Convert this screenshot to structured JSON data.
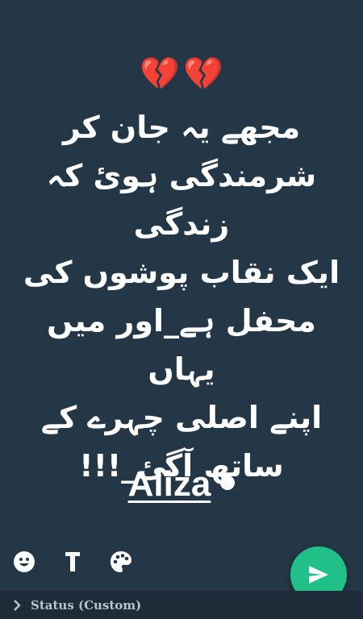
{
  "canvas": {
    "background": "#243746",
    "emoji": [
      "💔",
      "💔"
    ],
    "status_text": "مجھے یہ جان کر\nشرمندگی ہوئ کہ زندگی\nایک نقاب پوشوں کی\nمحفل ہے_اور میں یہاں\nاپنے اصلی چہرے کے\nساتھ آگئ_!!!",
    "signature": "Aliza"
  },
  "toolbar": {
    "emoji_icon": "smiley-icon",
    "text_icon": "text-T-icon",
    "color_icon": "palette-icon"
  },
  "send": {
    "icon": "send-arrow-icon",
    "color": "#21c089"
  },
  "bottom_bar": {
    "icon": "chevron-right-icon",
    "label": "Status (Custom)"
  }
}
